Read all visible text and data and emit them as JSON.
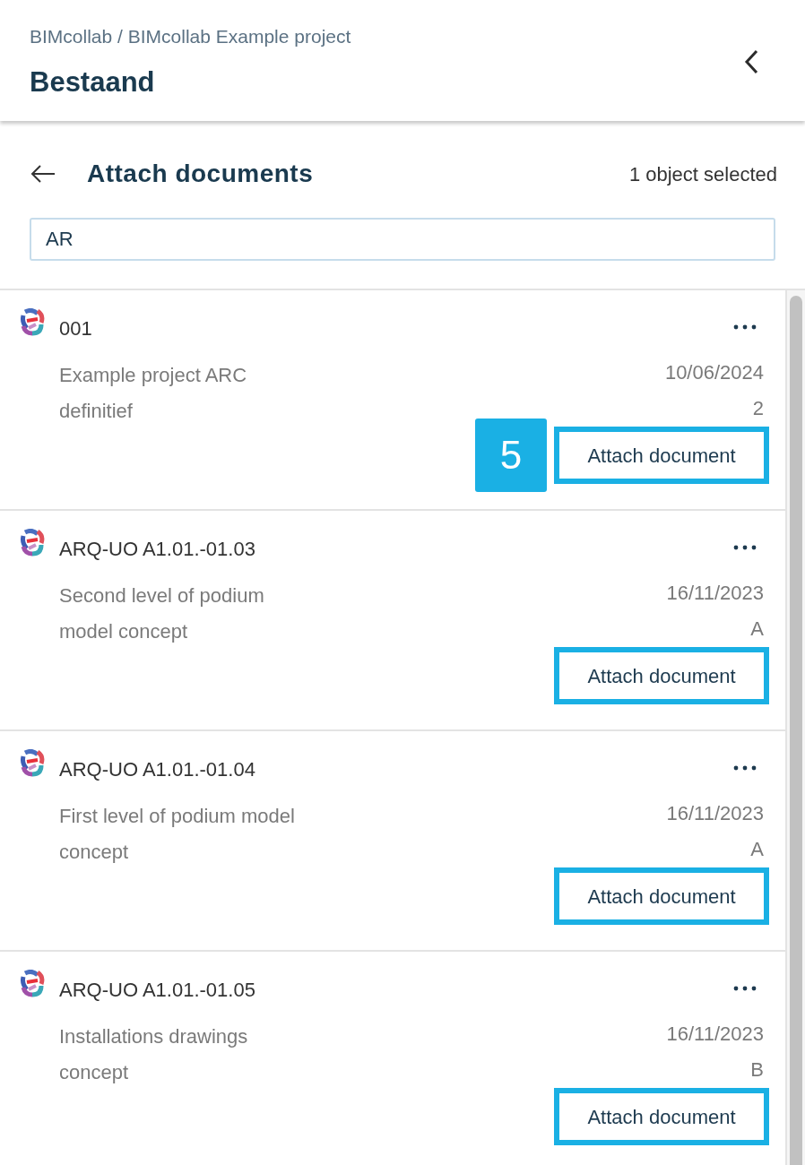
{
  "header": {
    "breadcrumb": "BIMcollab / BIMcollab Example project",
    "title": "Bestaand"
  },
  "panel": {
    "title": "Attach documents",
    "selection": "1 object selected"
  },
  "search": {
    "value": "AR"
  },
  "documents": [
    {
      "name": "001",
      "description": "Example project ARC definitief",
      "date": "10/06/2024",
      "version": "2",
      "step_badge": "5",
      "button": "Attach document",
      "highlighted": true
    },
    {
      "name": "ARQ-UO A1.01.-01.03",
      "description": "Second level of podium model concept",
      "date": "16/11/2023",
      "version": "A",
      "button": "Attach document",
      "highlighted": true
    },
    {
      "name": "ARQ-UO A1.01.-01.04",
      "description": "First level of podium model concept",
      "date": "16/11/2023",
      "version": "A",
      "button": "Attach document",
      "highlighted": true
    },
    {
      "name": "ARQ-UO A1.01.-01.05",
      "description": "Installations drawings concept",
      "date": "16/11/2023",
      "version": "B",
      "button": "Attach document",
      "highlighted": true
    }
  ]
}
